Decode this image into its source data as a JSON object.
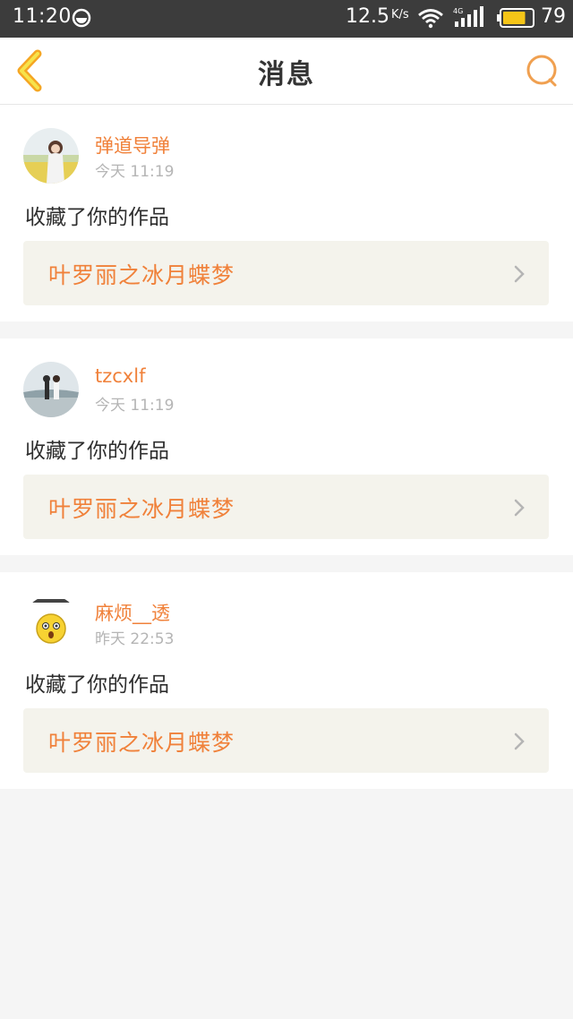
{
  "status_bar": {
    "time": "11:20",
    "net_speed": "12.5",
    "net_speed_unit": "K/s",
    "network_type": "4G",
    "battery_percent": "79",
    "battery_level": 0.79
  },
  "header": {
    "title": "消息",
    "accent_color": "#f0813a"
  },
  "messages": [
    {
      "username": "弹道导弹",
      "time": "今天 11:19",
      "action": "收藏了你的作品",
      "work_title": "叶罗丽之冰月蝶梦"
    },
    {
      "username": "tzcxlf",
      "time": "今天 11:19",
      "action": "收藏了你的作品",
      "work_title": "叶罗丽之冰月蝶梦"
    },
    {
      "username": "麻烦__透",
      "time": "昨天 22:53",
      "action": "收藏了你的作品",
      "work_title": "叶罗丽之冰月蝶梦"
    }
  ]
}
